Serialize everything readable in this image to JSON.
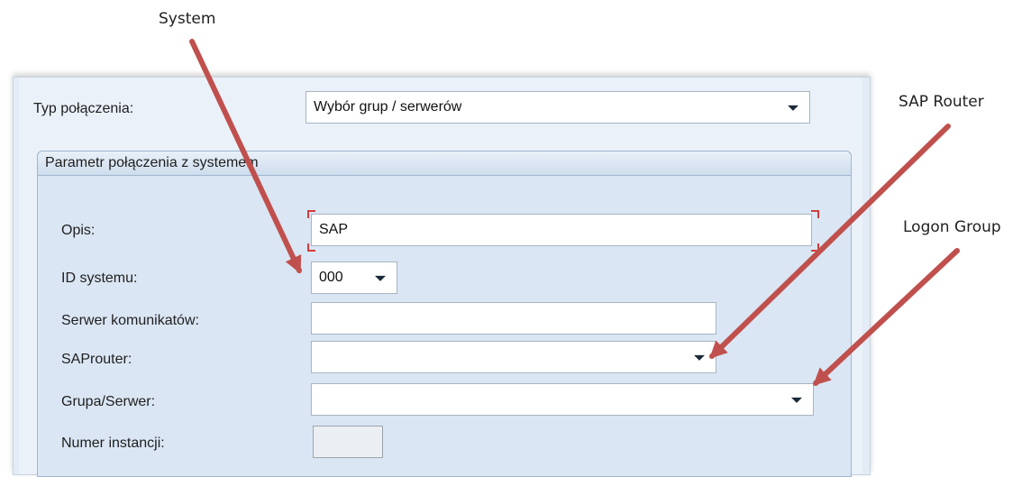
{
  "callouts": {
    "system": "System",
    "sap_router": "SAP Router",
    "logon_group": "Logon Group"
  },
  "dialog": {
    "connection_type_label": "Typ połączenia:",
    "connection_type_value": "Wybór grup / serwerów",
    "group_title": "Parametr połączenia z systemem",
    "fields": {
      "description_label": "Opis:",
      "description_value": "SAP",
      "system_id_label": "ID systemu:",
      "system_id_value": "000",
      "message_server_label": "Serwer komunikatów:",
      "message_server_value": "",
      "saprouter_label": "SAProuter:",
      "saprouter_value": "",
      "group_server_label": "Grupa/Serwer:",
      "group_server_value": "",
      "instance_number_label": "Numer instancji:",
      "instance_number_value": ""
    }
  },
  "colors": {
    "arrow": "#c0504d",
    "dialog_bg": "#e3ecf6",
    "group_bg": "#dae6f3",
    "required_marker": "#d43c3c"
  }
}
